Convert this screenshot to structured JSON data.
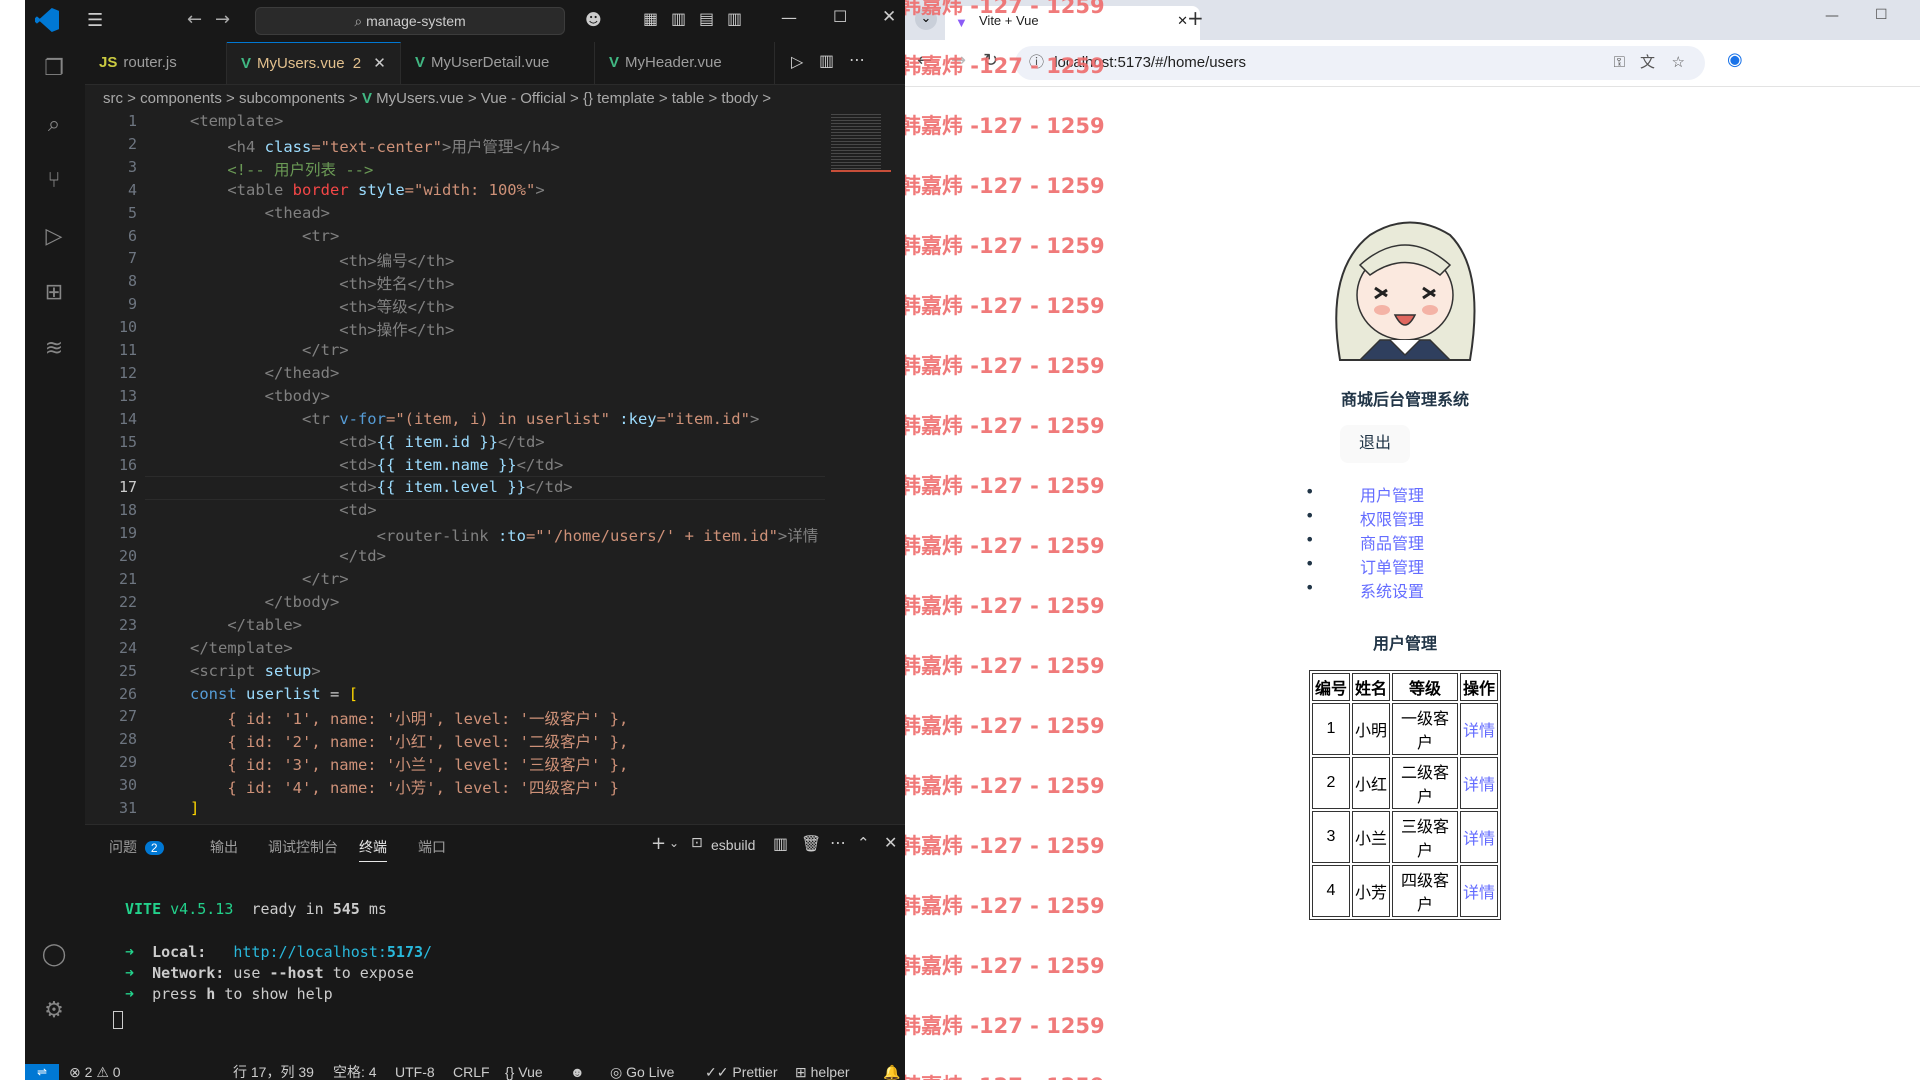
{
  "vscode": {
    "search_text": "manage-system",
    "tabs": [
      {
        "icon": "JS",
        "label": "router.js"
      },
      {
        "icon": "V",
        "label": "MyUsers.vue",
        "badge": "2"
      },
      {
        "icon": "V",
        "label": "MyUserDetail.vue"
      },
      {
        "icon": "V",
        "label": "MyHeader.vue"
      }
    ],
    "breadcrumb": [
      "src",
      "components",
      "subcomponents",
      "MyUsers.vue",
      "Vue - Official",
      "{} template",
      "table",
      "tbody"
    ],
    "line_numbers": [
      "1",
      "2",
      "3",
      "4",
      "5",
      "6",
      "7",
      "8",
      "9",
      "10",
      "11",
      "12",
      "13",
      "14",
      "15",
      "16",
      "17",
      "18",
      "19",
      "20",
      "21",
      "22",
      "23",
      "24",
      "25",
      "26",
      "27",
      "28",
      "29",
      "30",
      "31"
    ],
    "code": {
      "l1": "<template>",
      "l2a": "    <h4 ",
      "l2b": "class",
      "l2c": "=\"text-center\"",
      "l2d": ">用户管理</h4>",
      "l3": "    <!-- 用户列表 -->",
      "l4a": "    <table ",
      "l4b": "border",
      "l4c": " style",
      "l4d": "=\"width: 100%\"",
      "l4e": ">",
      "l5": "        <thead>",
      "l6": "            <tr>",
      "l7": "                <th>编号</th>",
      "l8": "                <th>姓名</th>",
      "l9": "                <th>等级</th>",
      "l10": "                <th>操作</th>",
      "l11": "            </tr>",
      "l12": "        </thead>",
      "l13": "        <tbody>",
      "l14a": "            <tr ",
      "l14b": "v-for",
      "l14c": "=\"(item, i) in userlist\"",
      "l14d": " :key",
      "l14e": "=\"item.id\"",
      "l14f": ">",
      "l15a": "                <td>",
      "l15b": "{{ item.id }}",
      "l15c": "</td>",
      "l16a": "                <td>",
      "l16b": "{{ item.name }}",
      "l16c": "</td>",
      "l17a": "                <td>",
      "l17b": "{{ item.level }}",
      "l17c": "</td>",
      "l18": "                <td>",
      "l19a": "                    <router-link ",
      "l19b": ":to",
      "l19c": "=\"'/home/users/' + item.id\"",
      "l19d": ">详情",
      "l20": "                </td>",
      "l21": "            </tr>",
      "l22": "        </tbody>",
      "l23": "    </table>",
      "l24": "</template>",
      "l25a": "<script ",
      "l25b": "setup",
      "l25c": ">",
      "l26a": "const ",
      "l26b": "userlist",
      "l26c": " = ",
      "l26d": "[",
      "l27": "    { id: '1', name: '小明', level: '一级客户' },",
      "l28": "    { id: '2', name: '小红', level: '二级客户' },",
      "l29": "    { id: '3', name: '小兰', level: '三级客户' },",
      "l30": "    { id: '4', name: '小芳', level: '四级客户' }",
      "l31": "]"
    },
    "panel_tabs": [
      "问题",
      "输出",
      "调试控制台",
      "终端",
      "端口"
    ],
    "problems_badge": "2",
    "terminal_name": "esbuild",
    "terminal": {
      "vite": "VITE",
      "version": "v4.5.13",
      "ready": "ready in",
      "ms_value": "545",
      "ms": "ms",
      "arrow": "➜",
      "local_label": "Local:",
      "local_url_a": "http://localhost:",
      "local_url_port": "5173",
      "local_url_b": "/",
      "network_label": "Network:",
      "network_text_a": "use ",
      "network_flag": "--host",
      "network_text_b": " to expose",
      "help_a": "press ",
      "help_key": "h",
      "help_b": " to show help"
    },
    "status": {
      "errors": "2",
      "warnings": "0",
      "cursor": "行 17，列 39",
      "spaces": "空格: 4",
      "encoding": "UTF-8",
      "eol": "CRLF",
      "language": "Vue",
      "golive": "Go Live",
      "prettier": "Prettier",
      "helper": "helper"
    }
  },
  "browser": {
    "tab_title": "Vite + Vue",
    "url": "localhost:5173/#/home/users",
    "watermark": "韩嘉炜 -127 - 1259",
    "site_title": "商城后台管理系统",
    "logout": "退出",
    "nav": [
      "用户管理",
      "权限管理",
      "商品管理",
      "订单管理",
      "系统设置"
    ],
    "page_heading": "用户管理",
    "table_headers": [
      "编号",
      "姓名",
      "等级",
      "操作"
    ],
    "rows": [
      {
        "id": "1",
        "name": "小明",
        "level": "一级客户",
        "action": "详情"
      },
      {
        "id": "2",
        "name": "小红",
        "level": "二级客户",
        "action": "详情"
      },
      {
        "id": "3",
        "name": "小兰",
        "level": "三级客户",
        "action": "详情"
      },
      {
        "id": "4",
        "name": "小芳",
        "level": "四级客户",
        "action": "详情"
      }
    ]
  }
}
